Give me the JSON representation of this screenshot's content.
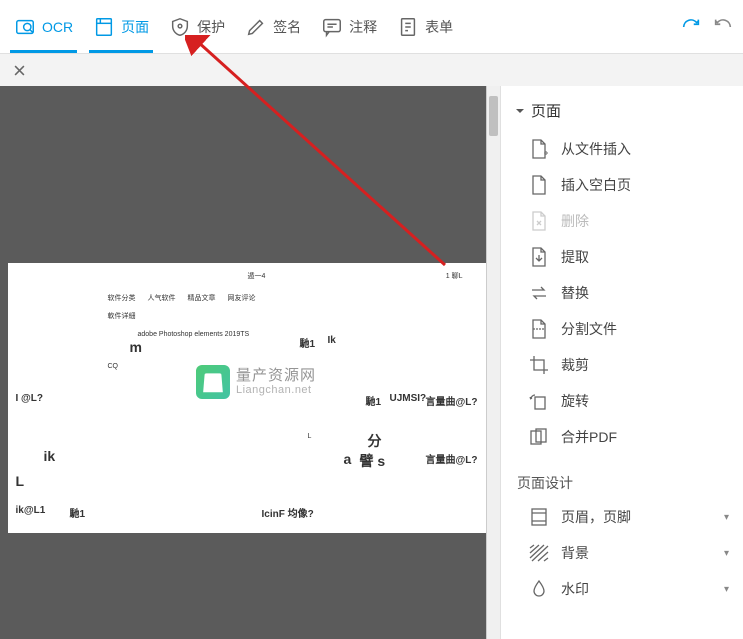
{
  "toolbar": {
    "ocr": "OCR",
    "page": "页面",
    "protect": "保护",
    "sign": "签名",
    "comment": "注释",
    "form": "表单"
  },
  "watermark": {
    "title": "量产资源网",
    "url": "Liangchan.net"
  },
  "panel": {
    "header": "页面",
    "items": {
      "insert_from_file": "从文件插入",
      "insert_blank": "插入空白页",
      "delete": "删除",
      "extract": "提取",
      "replace": "替换",
      "split": "分割文件",
      "crop": "裁剪",
      "rotate": "旋转",
      "merge": "合并PDF"
    },
    "design_header": "页面设计",
    "design": {
      "header_footer": "页眉，页脚",
      "background": "背景",
      "watermark": "水印"
    }
  },
  "doc": {
    "t1": "遁一4",
    "t2": "1 聊L",
    "t3": "软件分类",
    "t4": "人气软件",
    "t5": "精品文章",
    "t6": "网友评论",
    "t7": "軟件详細",
    "t8": "adobe Photoshop elements 2019TS",
    "t9": "m",
    "t10": "馳1",
    "t11": "Ik",
    "t12": "CQ",
    "t13": "I @L?",
    "t14": "馳1",
    "t15": "UJMSI?",
    "t16": "言量曲@L?",
    "t17": "ik",
    "t18": "L",
    "t19": "分",
    "t20": "譬 s",
    "t21": "言量曲@L?",
    "t22": "L",
    "t23": "ik@L1",
    "t24": "馳1",
    "t25": "IcinF 均像?",
    "t26": "a"
  }
}
